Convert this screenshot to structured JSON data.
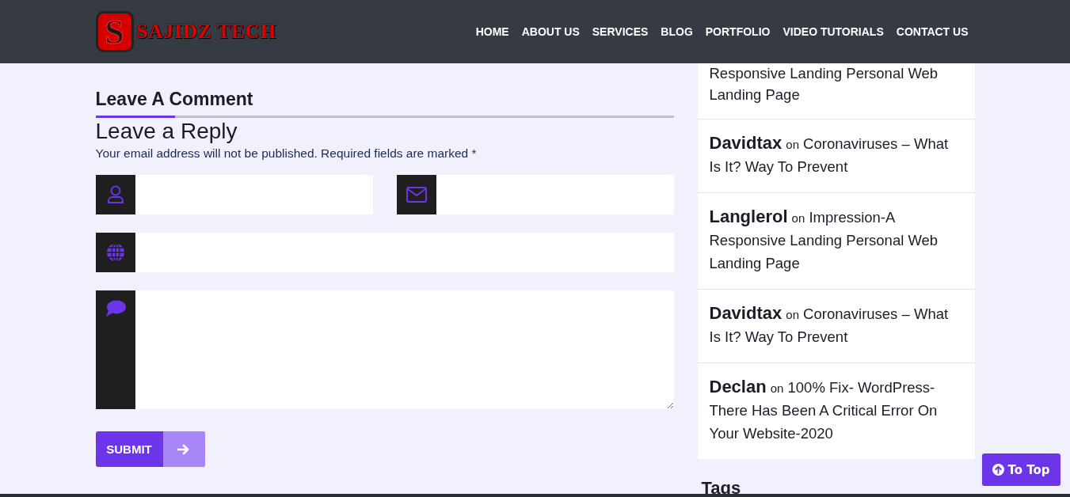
{
  "header": {
    "logo": {
      "emblem_letter": "S",
      "name": "SAJIDZ TECH"
    },
    "nav": [
      {
        "label": "HOME"
      },
      {
        "label": "ABOUT US"
      },
      {
        "label": "SERVICES"
      },
      {
        "label": "BLOG"
      },
      {
        "label": "PORTFOLIO"
      },
      {
        "label": "VIDEO TUTORIALS"
      },
      {
        "label": "CONTACT US"
      }
    ]
  },
  "comment_form": {
    "section_title": "Leave A Comment",
    "reply_title": "Leave a Reply",
    "notice": "Your email address will not be published. Required fields are marked *",
    "fields": [
      {
        "kind": "name"
      },
      {
        "kind": "email"
      },
      {
        "kind": "website"
      },
      {
        "kind": "comment"
      }
    ],
    "submit": {
      "label": "SUBMIT"
    }
  },
  "sidebar": {
    "recent_comments": [
      {
        "kind": "continued",
        "post": "Responsive Landing Personal Web Landing Page"
      },
      {
        "kind": "comment",
        "author": "Davidtax",
        "connector": "on",
        "post": "Coronaviruses – What Is It? Way To Prevent"
      },
      {
        "kind": "comment",
        "author": "Langlerol",
        "connector": "on",
        "post": "Impression-A Responsive Landing Personal Web Landing Page"
      },
      {
        "kind": "comment",
        "author": "Davidtax",
        "connector": "on",
        "post": "Coronaviruses – What Is It? Way To Prevent"
      },
      {
        "kind": "comment",
        "author": "Declan",
        "connector": "on",
        "post": "100% Fix- WordPress- There Has Been A Critical Error On Your Website-2020"
      }
    ],
    "tags_title": "Tags"
  },
  "to_top": {
    "label": "To Top"
  }
}
